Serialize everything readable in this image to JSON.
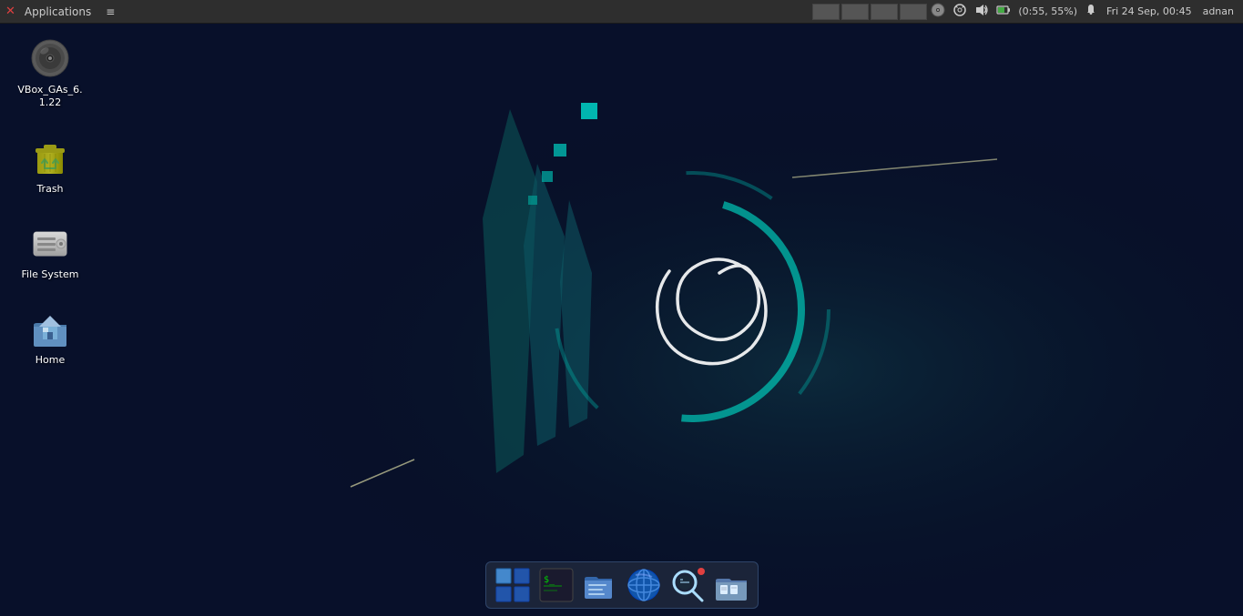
{
  "menubar": {
    "app_icon": "✕",
    "app_label": "Applications",
    "separator": "≡",
    "workspace_buttons": [
      "",
      "",
      "",
      ""
    ],
    "tray": {
      "cd_icon": "💿",
      "search_icon": "🔍",
      "audio_icon": "🔊",
      "battery_text": "(0:55, 55%)",
      "bell_icon": "🔔",
      "clock": "Fri 24 Sep, 00:45",
      "username": "adnan"
    }
  },
  "desktop": {
    "icons": [
      {
        "id": "vbox",
        "label": "VBox_GAs_6.\n1.22",
        "label_line1": "VBox_GAs_6.",
        "label_line2": "1.22",
        "type": "cd"
      },
      {
        "id": "trash",
        "label": "Trash",
        "type": "trash"
      },
      {
        "id": "filesystem",
        "label": "File System",
        "type": "drive"
      },
      {
        "id": "home",
        "label": "Home",
        "type": "home"
      }
    ]
  },
  "taskbar": {
    "items": [
      {
        "id": "workspace-switcher",
        "label": "Workspace Switcher"
      },
      {
        "id": "terminal",
        "label": "Terminal"
      },
      {
        "id": "files",
        "label": "Files"
      },
      {
        "id": "browser",
        "label": "Web Browser"
      },
      {
        "id": "search",
        "label": "Search"
      },
      {
        "id": "file-manager",
        "label": "File Manager"
      }
    ]
  }
}
